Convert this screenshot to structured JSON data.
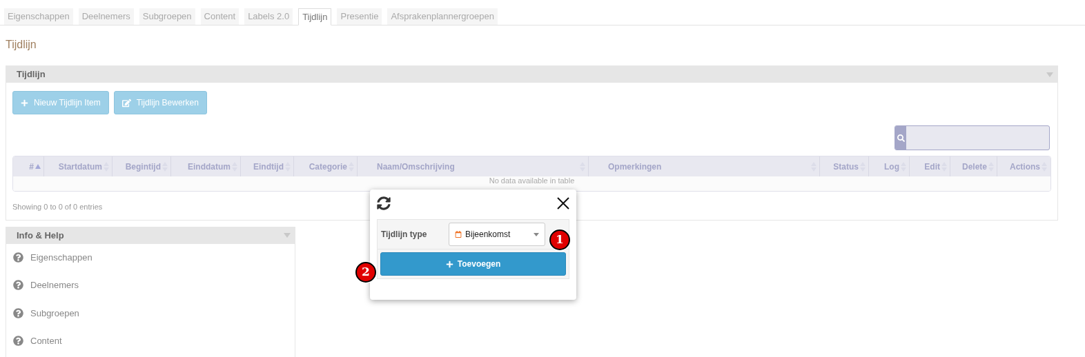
{
  "tabs": [
    {
      "label": "Eigenschappen",
      "selected": false
    },
    {
      "label": "Deelnemers",
      "selected": false
    },
    {
      "label": "Subgroepen",
      "selected": false
    },
    {
      "label": "Content",
      "selected": false
    },
    {
      "label": "Labels 2.0",
      "selected": false
    },
    {
      "label": "Tijdlijn",
      "selected": true
    },
    {
      "label": "Presentie",
      "selected": false
    },
    {
      "label": "Afsprakenplannergroepen",
      "selected": false
    }
  ],
  "page_title": "Tijdlijn",
  "timeline_panel": {
    "title": "Tijdlijn",
    "buttons": [
      {
        "label": "Nieuw Tijdlijn Item",
        "kind": "add"
      },
      {
        "label": "Tijdlijn Bewerken",
        "kind": "edit"
      }
    ],
    "table": {
      "columns": [
        {
          "label": "#",
          "sorted": true
        },
        {
          "label": "Startdatum",
          "sorted": false
        },
        {
          "label": "Begintijd",
          "sorted": false
        },
        {
          "label": "Einddatum",
          "sorted": false
        },
        {
          "label": "Eindtijd",
          "sorted": false
        },
        {
          "label": "Categorie",
          "sorted": false
        },
        {
          "label": "Naam/Omschrijving",
          "sorted": false
        },
        {
          "label": "Opmerkingen",
          "sorted": false
        },
        {
          "label": "Status",
          "sorted": false
        },
        {
          "label": "Log",
          "sorted": false
        },
        {
          "label": "Edit",
          "sorted": false
        },
        {
          "label": "Delete",
          "sorted": false
        },
        {
          "label": "Actions",
          "sorted": false
        }
      ],
      "empty_message": "No data available in table"
    },
    "info": "Showing 0 to 0 of 0 entries"
  },
  "help_panel": {
    "title": "Info & Help",
    "items": [
      "Eigenschappen",
      "Deelnemers",
      "Subgroepen",
      "Content"
    ]
  },
  "popup": {
    "field_label": "Tijdlijn type",
    "select_value": "Bijeenkomst",
    "button": "Toevoegen",
    "markers": [
      "1",
      "2"
    ]
  }
}
